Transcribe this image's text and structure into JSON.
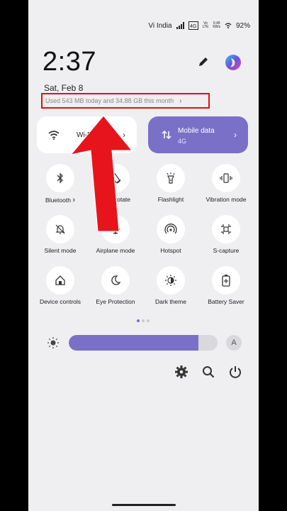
{
  "status_bar": {
    "carrier": "Vi India",
    "net_label": "Vo\nLTE",
    "speed": "0.49\nKB/s",
    "battery": "92%"
  },
  "header": {
    "time": "2:37",
    "date": "Sat, Feb 8",
    "usage": "Used 543 MB today and 34.88 GB this month"
  },
  "tiles": {
    "wifi": {
      "label": "Wi-Fi"
    },
    "mobile": {
      "label": "Mobile data",
      "sub": "4G"
    }
  },
  "quick_settings": [
    {
      "label": "Bluetooth",
      "icon": "bluetooth-icon"
    },
    {
      "label": "Auto-rotate",
      "icon": "auto-rotate-icon"
    },
    {
      "label": "Flashlight",
      "icon": "flashlight-icon"
    },
    {
      "label": "Vibration mode",
      "icon": "vibration-icon"
    },
    {
      "label": "Silent mode",
      "icon": "silent-icon"
    },
    {
      "label": "Airplane mode",
      "icon": "airplane-icon"
    },
    {
      "label": "Hotspot",
      "icon": "hotspot-icon"
    },
    {
      "label": "S-capture",
      "icon": "screenshot-icon"
    },
    {
      "label": "Device controls",
      "icon": "home-icon"
    },
    {
      "label": "Eye Protection",
      "icon": "moon-icon"
    },
    {
      "label": "Dark theme",
      "icon": "dark-theme-icon"
    },
    {
      "label": "Battery Saver",
      "icon": "battery-saver-icon"
    }
  ],
  "brightness": {
    "level": 0.87,
    "auto_label": "A"
  },
  "colors": {
    "accent": "#7b70c8",
    "highlight": "#e01010"
  }
}
